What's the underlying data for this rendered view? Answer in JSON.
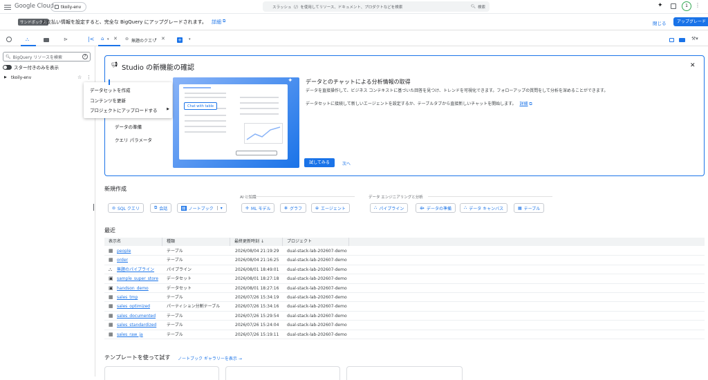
{
  "topbar": {
    "logo": "Google Cloud",
    "project": "tkoily-env",
    "search_placeholder": "スラッシュ（/）を使用してリソース、ドキュメント、プロダクトなどを検索",
    "search_button": "検索",
    "avatar_letter": "1"
  },
  "banner": {
    "badge": "サンドボックス",
    "message": "お支払い情報を設定すると、完全な BigQuery にアップグレードされます。",
    "details_link": "詳細",
    "close": "閉じる",
    "upgrade": "アップグレード"
  },
  "tabs": {
    "untitled_query": "無題のクエリ"
  },
  "left": {
    "search_placeholder": "BigQuery リソースを検索",
    "starred_only": "スター付きのみを表示",
    "project": "tkoily-env"
  },
  "context_menu": {
    "items": [
      "データセットを作成",
      "コンテンツを更新",
      "プロジェクトにアップロードする"
    ]
  },
  "studio": {
    "title": "Studio の新機能の確認",
    "side_items": [
      "データの準備",
      "クエリ パラメータ"
    ],
    "illustration_chip": "Chat with table",
    "heading": "データとのチャットによる分析情報の取得",
    "desc1": "データを直接操作して、ビジネス コンテキストに基づいた回答を見つけ、トレンドを可視化できます。フォローアップの質問をして分析を深めることができます。",
    "desc2": "データセットに接続して新しいエージェントを設定するか、テーブルタブから直接新しいチャットを開始します。",
    "details_link": "詳細",
    "try_button": "試してみる",
    "next_button": "次へ"
  },
  "create": {
    "title": "新規作成",
    "group_ai": "AI と知識",
    "group_de": "データ エンジニアリングと分析",
    "buttons": [
      "SQL クエリ",
      "会話",
      "ノートブック",
      "ML モデル",
      "グラフ",
      "エージェント",
      "パイプライン",
      "データの準備",
      "データ キャンバス",
      "テーブル"
    ]
  },
  "recent": {
    "title": "最近",
    "columns": [
      "表示名",
      "種類",
      "最終更新時刻",
      "プロジェクト"
    ],
    "rows": [
      {
        "name": "people",
        "type": "テーブル",
        "time": "2026/08/04 21:19:29",
        "project": "dual-stack-lab-202607-demo",
        "icon": "table-icon"
      },
      {
        "name": "order",
        "type": "テーブル",
        "time": "2026/08/04 21:16:25",
        "project": "dual-stack-lab-202607-demo",
        "icon": "table-icon"
      },
      {
        "name": "無題のパイプライン",
        "type": "パイプライン",
        "time": "2026/08/01 18:49:01",
        "project": "dual-stack-lab-202607-demo",
        "icon": "pipeline-icon"
      },
      {
        "name": "sample_super_store",
        "type": "データセット",
        "time": "2026/08/01 18:27:18",
        "project": "dual-stack-lab-202607-demo",
        "icon": "dataset-icon"
      },
      {
        "name": "handson_demo",
        "type": "データセット",
        "time": "2026/08/01 18:27:16",
        "project": "dual-stack-lab-202607-demo",
        "icon": "dataset-icon"
      },
      {
        "name": "sales_tmp",
        "type": "テーブル",
        "time": "2026/07/26 15:34:19",
        "project": "dual-stack-lab-202607-demo",
        "icon": "table-icon"
      },
      {
        "name": "sales_optimized",
        "type": "パーティション分割テーブル",
        "time": "2026/07/26 15:34:16",
        "project": "dual-stack-lab-202607-demo",
        "icon": "table-icon"
      },
      {
        "name": "sales_documented",
        "type": "テーブル",
        "time": "2026/07/26 15:29:54",
        "project": "dual-stack-lab-202607-demo",
        "icon": "table-icon"
      },
      {
        "name": "sales_standardized",
        "type": "テーブル",
        "time": "2026/07/26 15:24:04",
        "project": "dual-stack-lab-202607-demo",
        "icon": "table-icon"
      },
      {
        "name": "sales_raw_ja",
        "type": "テーブル",
        "time": "2026/07/26 15:19:11",
        "project": "dual-stack-lab-202607-demo",
        "icon": "table-icon"
      }
    ]
  },
  "templates": {
    "title": "テンプレートを使って試す",
    "gallery_link": "ノートブック ギャラリーを表示"
  },
  "colors": {
    "accent": "#1a73e8",
    "primary_button": "#1a73e8",
    "banner_badge": "#5f6368"
  }
}
